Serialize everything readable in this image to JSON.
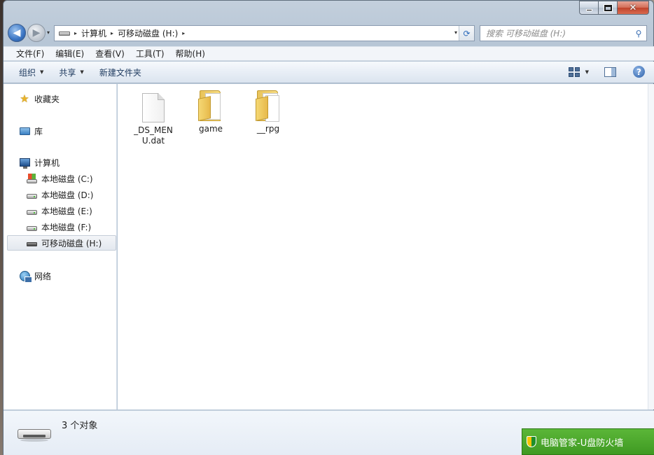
{
  "window": {
    "caption_close": "✕"
  },
  "nav": {
    "back_arrow": "◀",
    "forward_arrow": "▶",
    "dropdown": "▾"
  },
  "address": {
    "separator": "▸",
    "crumbs": [
      "计算机",
      "可移动磁盘 (H:)"
    ],
    "dropdown": "▾",
    "refresh_icon": "⟳"
  },
  "search": {
    "placeholder": "搜索 可移动磁盘 (H:)",
    "icon": "⚲"
  },
  "menu": {
    "items": [
      "文件(F)",
      "编辑(E)",
      "查看(V)",
      "工具(T)",
      "帮助(H)"
    ]
  },
  "command_bar": {
    "organize": "组织",
    "share": "共享",
    "new_folder": "新建文件夹",
    "caret": "▼",
    "help": "?"
  },
  "sidebar": {
    "favorites": "收藏夹",
    "libraries": "库",
    "computer": "计算机",
    "drives": [
      {
        "label": "本地磁盘 (C:)",
        "icon": "system-drive-icon"
      },
      {
        "label": "本地磁盘 (D:)",
        "icon": "drive-icon"
      },
      {
        "label": "本地磁盘 (E:)",
        "icon": "drive-icon"
      },
      {
        "label": "本地磁盘 (F:)",
        "icon": "drive-icon"
      },
      {
        "label": "可移动磁盘 (H:)",
        "icon": "usb-drive-icon",
        "selected": true
      }
    ],
    "network": "网络"
  },
  "files": [
    {
      "name": "_DS_MENU.dat",
      "type": "file"
    },
    {
      "name": "game",
      "type": "folder"
    },
    {
      "name": "__rpg",
      "type": "folder"
    }
  ],
  "details": {
    "count": "3 个对象"
  },
  "tray_popup": {
    "text": "电脑管家-U盘防火墙"
  },
  "colors": {
    "accent": "#3a75c4",
    "tray_green": "#4aa82a",
    "folder_yellow": "#f0cf6e"
  }
}
